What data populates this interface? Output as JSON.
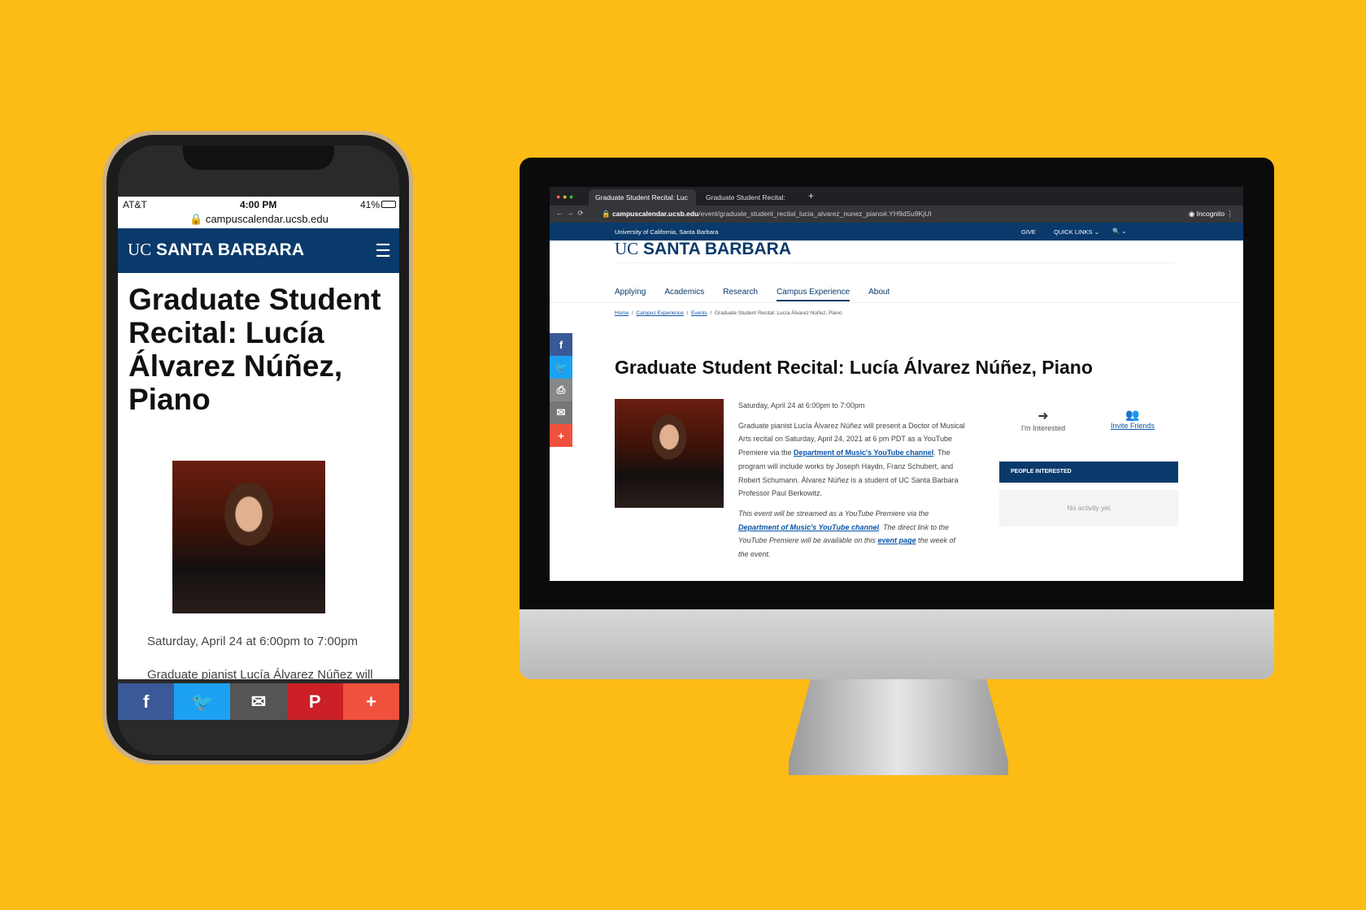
{
  "phone": {
    "carrier": "AT&T",
    "time": "4:00 PM",
    "battery": "41%",
    "url": "campuscalendar.ucsb.edu",
    "logo_uc": "UC",
    "logo_sb": "SANTA BARBARA",
    "title": "Graduate Student Recital: Lucía Álvarez Núñez, Piano",
    "date": "Saturday, April 24 at 6:00pm to 7:00pm",
    "desc_start": "Graduate pianist Lucía Álvarez Núñez will",
    "share": [
      {
        "icon": "facebook-icon",
        "glyph": "f",
        "color": "#3b5998"
      },
      {
        "icon": "twitter-icon",
        "glyph": "🐦",
        "color": "#1da1f2"
      },
      {
        "icon": "email-icon",
        "glyph": "✉",
        "color": "#555555"
      },
      {
        "icon": "pinterest-icon",
        "glyph": "P",
        "color": "#cb2027"
      },
      {
        "icon": "plus-icon",
        "glyph": "+",
        "color": "#f0513c"
      }
    ]
  },
  "desktop": {
    "tabs": [
      "Graduate Student Recital: Luc",
      "Graduate Student Recital: Chi"
    ],
    "url_domain": "campuscalendar.ucsb.edu",
    "url_path": "/event/graduate_student_recital_lucia_alvarez_nunez_piano#.YH9dSu9KjUI",
    "incognito": "Incognito",
    "util_left": "University of California, Santa Barbara",
    "give": "GIVE",
    "quick_links": "QUICK LINKS ⌄",
    "search": "🔍 ⌄",
    "logo_uc": "UC",
    "logo_sb": "SANTA BARBARA",
    "nav": [
      "Applying",
      "Academics",
      "Research",
      "Campus Experience",
      "About"
    ],
    "nav_active": "Campus Experience",
    "breadcrumb": [
      "Home",
      "Campus Experience",
      "Events",
      "Graduate Student Recital: Lucía Álvarez Núñez, Piano"
    ],
    "title": "Graduate Student Recital: Lucía Álvarez Núñez, Piano",
    "date": "Saturday, April 24 at 6:00pm to 7:00pm",
    "desc1": "Graduate pianist Lucía Álvarez Núñez will present a Doctor of Musical Arts recital on Saturday, April 24, 2021 at 6 pm PDT as a YouTube Premiere via the ",
    "desc_link": "Department of Music's YouTube channel",
    "desc2": ". The program will include works by Joseph Haydn, Franz Schubert, and Robert Schumann. Álvarez Núñez is a student of UC Santa Barbara Professor Paul Berkowitz.",
    "stream1": "This event will be streamed as a YouTube Premiere via the ",
    "stream_link": "Department of Music's YouTube channel",
    "stream2": ". The direct link to the YouTube Premiere will be available on this ",
    "stream_link2": "event page",
    "stream3": " the week of the event.",
    "interested": "I'm Interested",
    "invite": "Invite Friends",
    "people_header": "PEOPLE INTERESTED",
    "no_activity": "No activity yet",
    "share": [
      {
        "icon": "facebook-icon",
        "glyph": "f",
        "color": "#3b5998"
      },
      {
        "icon": "twitter-icon",
        "glyph": "🐦",
        "color": "#1da1f2"
      },
      {
        "icon": "print-icon",
        "glyph": "⎙",
        "color": "#888888"
      },
      {
        "icon": "email-icon",
        "glyph": "✉",
        "color": "#777777"
      },
      {
        "icon": "plus-icon",
        "glyph": "+",
        "color": "#f0513c"
      }
    ]
  },
  "colors": {
    "background": "#fdbb16",
    "brand_navy": "#0a3a6b",
    "link": "#0a55a8"
  }
}
